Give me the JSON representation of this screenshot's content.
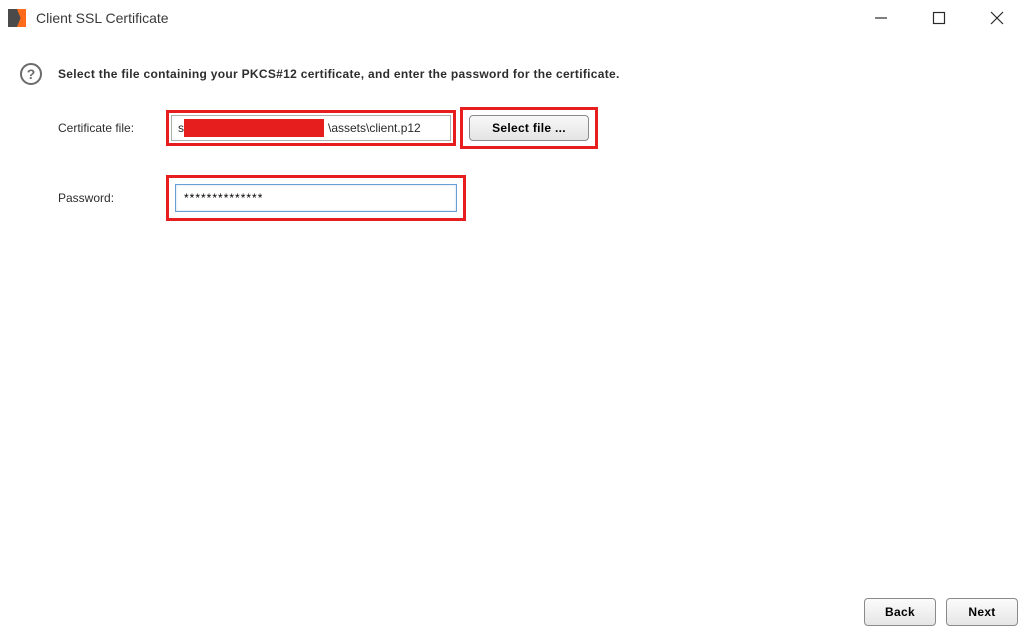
{
  "window": {
    "title": "Client SSL Certificate"
  },
  "instruction": "Select the file containing your PKCS#12 certificate, and enter the password for the certificate.",
  "form": {
    "cert_label": "Certificate file:",
    "cert_value_prefix": "s",
    "cert_value_suffix": "\\assets\\client.p12",
    "select_file_label": "Select file ...",
    "password_label": "Password:",
    "password_value": "**************"
  },
  "footer": {
    "back_label": "Back",
    "next_label": "Next"
  },
  "highlights": {
    "color": "#e61e1e"
  }
}
